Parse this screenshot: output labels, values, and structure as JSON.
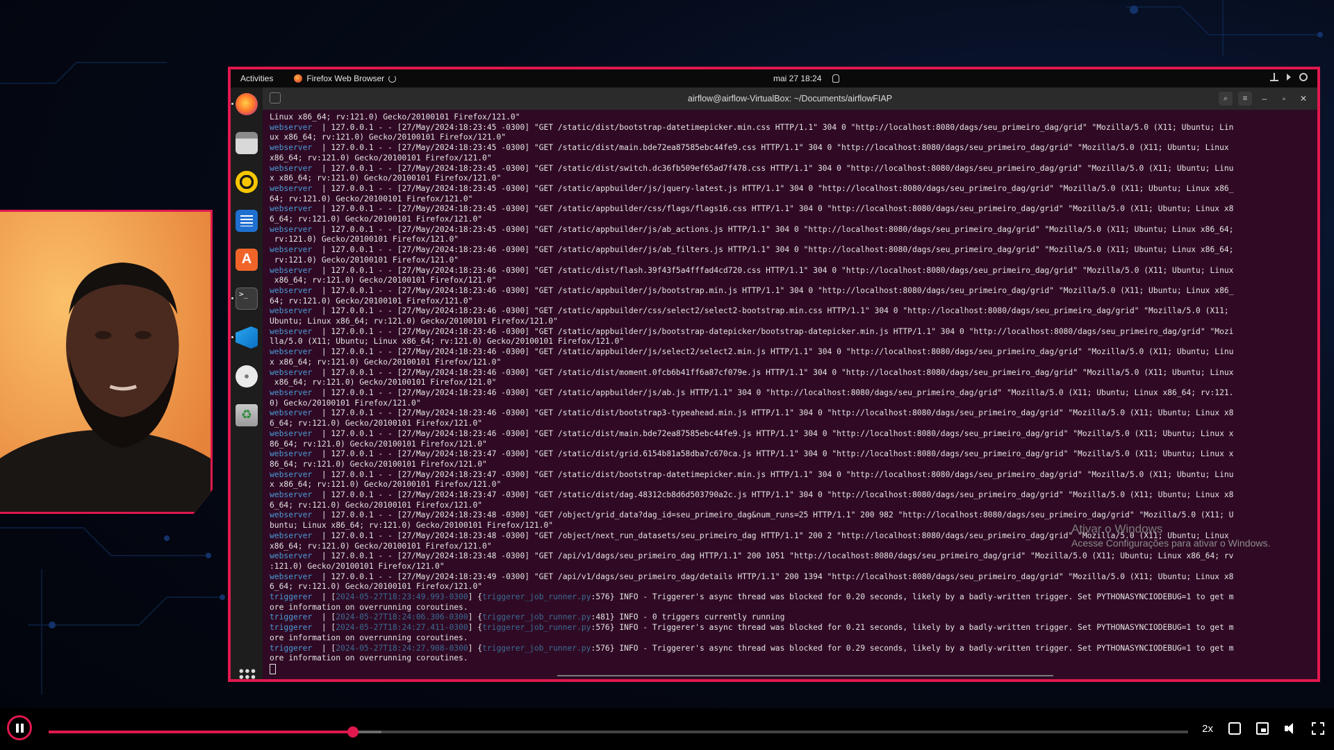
{
  "vm_topbar": {
    "activities": "Activities",
    "app_name": "Firefox Web Browser",
    "clock": "mai 27  18:24"
  },
  "terminal_window": {
    "title": "airflow@airflow-VirtualBox: ~/Documents/airflowFIAP"
  },
  "terminal_lines": [
    {
      "svc": "",
      "text": "Linux x86_64; rv:121.0) Gecko/20100101 Firefox/121.0\""
    },
    {
      "svc": "webserver",
      "text": "  | 127.0.0.1 - - [27/May/2024:18:23:45 -0300] \"GET /static/dist/bootstrap-datetimepicker.min.css HTTP/1.1\" 304 0 \"http://localhost:8080/dags/seu_primeiro_dag/grid\" \"Mozilla/5.0 (X11; Ubuntu; Lin"
    },
    {
      "svc": "",
      "text": "ux x86_64; rv:121.0) Gecko/20100101 Firefox/121.0\""
    },
    {
      "svc": "webserver",
      "text": "  | 127.0.0.1 - - [27/May/2024:18:23:45 -0300] \"GET /static/dist/main.bde72ea87585ebc44fe9.css HTTP/1.1\" 304 0 \"http://localhost:8080/dags/seu_primeiro_dag/grid\" \"Mozilla/5.0 (X11; Ubuntu; Linux"
    },
    {
      "svc": "",
      "text": "x86_64; rv:121.0) Gecko/20100101 Firefox/121.0\""
    },
    {
      "svc": "webserver",
      "text": "  | 127.0.0.1 - - [27/May/2024:18:23:45 -0300] \"GET /static/dist/switch.dc36fb509ef65ad7f478.css HTTP/1.1\" 304 0 \"http://localhost:8080/dags/seu_primeiro_dag/grid\" \"Mozilla/5.0 (X11; Ubuntu; Linu"
    },
    {
      "svc": "",
      "text": "x x86_64; rv:121.0) Gecko/20100101 Firefox/121.0\""
    },
    {
      "svc": "webserver",
      "text": "  | 127.0.0.1 - - [27/May/2024:18:23:45 -0300] \"GET /static/appbuilder/js/jquery-latest.js HTTP/1.1\" 304 0 \"http://localhost:8080/dags/seu_primeiro_dag/grid\" \"Mozilla/5.0 (X11; Ubuntu; Linux x86_"
    },
    {
      "svc": "",
      "text": "64; rv:121.0) Gecko/20100101 Firefox/121.0\""
    },
    {
      "svc": "webserver",
      "text": "  | 127.0.0.1 - - [27/May/2024:18:23:45 -0300] \"GET /static/appbuilder/css/flags/flags16.css HTTP/1.1\" 304 0 \"http://localhost:8080/dags/seu_primeiro_dag/grid\" \"Mozilla/5.0 (X11; Ubuntu; Linux x8"
    },
    {
      "svc": "",
      "text": "6_64; rv:121.0) Gecko/20100101 Firefox/121.0\""
    },
    {
      "svc": "webserver",
      "text": "  | 127.0.0.1 - - [27/May/2024:18:23:45 -0300] \"GET /static/appbuilder/js/ab_actions.js HTTP/1.1\" 304 0 \"http://localhost:8080/dags/seu_primeiro_dag/grid\" \"Mozilla/5.0 (X11; Ubuntu; Linux x86_64;"
    },
    {
      "svc": "",
      "text": " rv:121.0) Gecko/20100101 Firefox/121.0\""
    },
    {
      "svc": "webserver",
      "text": "  | 127.0.0.1 - - [27/May/2024:18:23:46 -0300] \"GET /static/appbuilder/js/ab_filters.js HTTP/1.1\" 304 0 \"http://localhost:8080/dags/seu_primeiro_dag/grid\" \"Mozilla/5.0 (X11; Ubuntu; Linux x86_64;"
    },
    {
      "svc": "",
      "text": " rv:121.0) Gecko/20100101 Firefox/121.0\""
    },
    {
      "svc": "webserver",
      "text": "  | 127.0.0.1 - - [27/May/2024:18:23:46 -0300] \"GET /static/dist/flash.39f43f5a4fffad4cd720.css HTTP/1.1\" 304 0 \"http://localhost:8080/dags/seu_primeiro_dag/grid\" \"Mozilla/5.0 (X11; Ubuntu; Linux"
    },
    {
      "svc": "",
      "text": " x86_64; rv:121.0) Gecko/20100101 Firefox/121.0\""
    },
    {
      "svc": "webserver",
      "text": "  | 127.0.0.1 - - [27/May/2024:18:23:46 -0300] \"GET /static/appbuilder/js/bootstrap.min.js HTTP/1.1\" 304 0 \"http://localhost:8080/dags/seu_primeiro_dag/grid\" \"Mozilla/5.0 (X11; Ubuntu; Linux x86_"
    },
    {
      "svc": "",
      "text": "64; rv:121.0) Gecko/20100101 Firefox/121.0\""
    },
    {
      "svc": "webserver",
      "text": "  | 127.0.0.1 - - [27/May/2024:18:23:46 -0300] \"GET /static/appbuilder/css/select2/select2-bootstrap.min.css HTTP/1.1\" 304 0 \"http://localhost:8080/dags/seu_primeiro_dag/grid\" \"Mozilla/5.0 (X11;"
    },
    {
      "svc": "",
      "text": "Ubuntu; Linux x86_64; rv:121.0) Gecko/20100101 Firefox/121.0\""
    },
    {
      "svc": "webserver",
      "text": "  | 127.0.0.1 - - [27/May/2024:18:23:46 -0300] \"GET /static/appbuilder/js/bootstrap-datepicker/bootstrap-datepicker.min.js HTTP/1.1\" 304 0 \"http://localhost:8080/dags/seu_primeiro_dag/grid\" \"Mozi"
    },
    {
      "svc": "",
      "text": "lla/5.0 (X11; Ubuntu; Linux x86_64; rv:121.0) Gecko/20100101 Firefox/121.0\""
    },
    {
      "svc": "webserver",
      "text": "  | 127.0.0.1 - - [27/May/2024:18:23:46 -0300] \"GET /static/appbuilder/js/select2/select2.min.js HTTP/1.1\" 304 0 \"http://localhost:8080/dags/seu_primeiro_dag/grid\" \"Mozilla/5.0 (X11; Ubuntu; Linu"
    },
    {
      "svc": "",
      "text": "x x86_64; rv:121.0) Gecko/20100101 Firefox/121.0\""
    },
    {
      "svc": "webserver",
      "text": "  | 127.0.0.1 - - [27/May/2024:18:23:46 -0300] \"GET /static/dist/moment.0fcb6b41ff6a87cf079e.js HTTP/1.1\" 304 0 \"http://localhost:8080/dags/seu_primeiro_dag/grid\" \"Mozilla/5.0 (X11; Ubuntu; Linux"
    },
    {
      "svc": "",
      "text": " x86_64; rv:121.0) Gecko/20100101 Firefox/121.0\""
    },
    {
      "svc": "webserver",
      "text": "  | 127.0.0.1 - - [27/May/2024:18:23:46 -0300] \"GET /static/appbuilder/js/ab.js HTTP/1.1\" 304 0 \"http://localhost:8080/dags/seu_primeiro_dag/grid\" \"Mozilla/5.0 (X11; Ubuntu; Linux x86_64; rv:121."
    },
    {
      "svc": "",
      "text": "0) Gecko/20100101 Firefox/121.0\""
    },
    {
      "svc": "webserver",
      "text": "  | 127.0.0.1 - - [27/May/2024:18:23:46 -0300] \"GET /static/dist/bootstrap3-typeahead.min.js HTTP/1.1\" 304 0 \"http://localhost:8080/dags/seu_primeiro_dag/grid\" \"Mozilla/5.0 (X11; Ubuntu; Linux x8"
    },
    {
      "svc": "",
      "text": "6_64; rv:121.0) Gecko/20100101 Firefox/121.0\""
    },
    {
      "svc": "webserver",
      "text": "  | 127.0.0.1 - - [27/May/2024:18:23:46 -0300] \"GET /static/dist/main.bde72ea87585ebc44fe9.js HTTP/1.1\" 304 0 \"http://localhost:8080/dags/seu_primeiro_dag/grid\" \"Mozilla/5.0 (X11; Ubuntu; Linux x"
    },
    {
      "svc": "",
      "text": "86_64; rv:121.0) Gecko/20100101 Firefox/121.0\""
    },
    {
      "svc": "webserver",
      "text": "  | 127.0.0.1 - - [27/May/2024:18:23:47 -0300] \"GET /static/dist/grid.6154b81a58dba7c670ca.js HTTP/1.1\" 304 0 \"http://localhost:8080/dags/seu_primeiro_dag/grid\" \"Mozilla/5.0 (X11; Ubuntu; Linux x"
    },
    {
      "svc": "",
      "text": "86_64; rv:121.0) Gecko/20100101 Firefox/121.0\""
    },
    {
      "svc": "webserver",
      "text": "  | 127.0.0.1 - - [27/May/2024:18:23:47 -0300] \"GET /static/dist/bootstrap-datetimepicker.min.js HTTP/1.1\" 304 0 \"http://localhost:8080/dags/seu_primeiro_dag/grid\" \"Mozilla/5.0 (X11; Ubuntu; Linu"
    },
    {
      "svc": "",
      "text": "x x86_64; rv:121.0) Gecko/20100101 Firefox/121.0\""
    },
    {
      "svc": "webserver",
      "text": "  | 127.0.0.1 - - [27/May/2024:18:23:47 -0300] \"GET /static/dist/dag.48312cb8d6d503790a2c.js HTTP/1.1\" 304 0 \"http://localhost:8080/dags/seu_primeiro_dag/grid\" \"Mozilla/5.0 (X11; Ubuntu; Linux x8"
    },
    {
      "svc": "",
      "text": "6_64; rv:121.0) Gecko/20100101 Firefox/121.0\""
    },
    {
      "svc": "webserver",
      "text": "  | 127.0.0.1 - - [27/May/2024:18:23:48 -0300] \"GET /object/grid_data?dag_id=seu_primeiro_dag&num_runs=25 HTTP/1.1\" 200 982 \"http://localhost:8080/dags/seu_primeiro_dag/grid\" \"Mozilla/5.0 (X11; U"
    },
    {
      "svc": "",
      "text": "buntu; Linux x86_64; rv:121.0) Gecko/20100101 Firefox/121.0\""
    },
    {
      "svc": "webserver",
      "text": "  | 127.0.0.1 - - [27/May/2024:18:23:48 -0300] \"GET /object/next_run_datasets/seu_primeiro_dag HTTP/1.1\" 200 2 \"http://localhost:8080/dags/seu_primeiro_dag/grid\" \"Mozilla/5.0 (X11; Ubuntu; Linux"
    },
    {
      "svc": "",
      "text": "x86_64; rv:121.0) Gecko/20100101 Firefox/121.0\""
    },
    {
      "svc": "webserver",
      "text": "  | 127.0.0.1 - - [27/May/2024:18:23:48 -0300] \"GET /api/v1/dags/seu_primeiro_dag HTTP/1.1\" 200 1051 \"http://localhost:8080/dags/seu_primeiro_dag/grid\" \"Mozilla/5.0 (X11; Ubuntu; Linux x86_64; rv"
    },
    {
      "svc": "",
      "text": ":121.0) Gecko/20100101 Firefox/121.0\""
    },
    {
      "svc": "webserver",
      "text": "  | 127.0.0.1 - - [27/May/2024:18:23:49 -0300] \"GET /api/v1/dags/seu_primeiro_dag/details HTTP/1.1\" 200 1394 \"http://localhost:8080/dags/seu_primeiro_dag/grid\" \"Mozilla/5.0 (X11; Ubuntu; Linux x8"
    },
    {
      "svc": "",
      "text": "6_64; rv:121.0) Gecko/20100101 Firefox/121.0\""
    },
    {
      "svc": "triggerer",
      "text": "  | [",
      "ts": "2024-05-27T18:23:49.993-0300",
      "mid": "] {",
      "file": "triggerer_job_runner.py",
      "tail": ":576} INFO - Triggerer's async thread was blocked for 0.20 seconds, likely by a badly-written trigger. Set PYTHONASYNCIODEBUG=1 to get m"
    },
    {
      "svc": "",
      "text": "ore information on overrunning coroutines."
    },
    {
      "svc": "triggerer",
      "text": "  | [",
      "ts": "2024-05-27T18:24:06.306-0300",
      "mid": "] {",
      "file": "triggerer_job_runner.py",
      "tail": ":481} INFO - 0 triggers currently running"
    },
    {
      "svc": "triggerer",
      "text": "  | [",
      "ts": "2024-05-27T18:24:27.411-0300",
      "mid": "] {",
      "file": "triggerer_job_runner.py",
      "tail": ":576} INFO - Triggerer's async thread was blocked for 0.21 seconds, likely by a badly-written trigger. Set PYTHONASYNCIODEBUG=1 to get m"
    },
    {
      "svc": "",
      "text": "ore information on overrunning coroutines."
    },
    {
      "svc": "triggerer",
      "text": "  | [",
      "ts": "2024-05-27T18:24:27.908-0300",
      "mid": "] {",
      "file": "triggerer_job_runner.py",
      "tail": ":576} INFO - Triggerer's async thread was blocked for 0.29 seconds, likely by a badly-written trigger. Set PYTHONASYNCIODEBUG=1 to get m"
    },
    {
      "svc": "",
      "text": "ore information on overrunning coroutines."
    }
  ],
  "windows_watermark": {
    "line1": "Ativar o Windows",
    "line2": "Acesse Configurações para ativar o Windows."
  },
  "player": {
    "progress_fraction": 0.267,
    "buffered_fraction": 0.292,
    "speed_label": "2x"
  },
  "colors": {
    "accent": "#e0184e",
    "terminal_bg": "#300a24",
    "service_label": "#4a9ad6"
  }
}
